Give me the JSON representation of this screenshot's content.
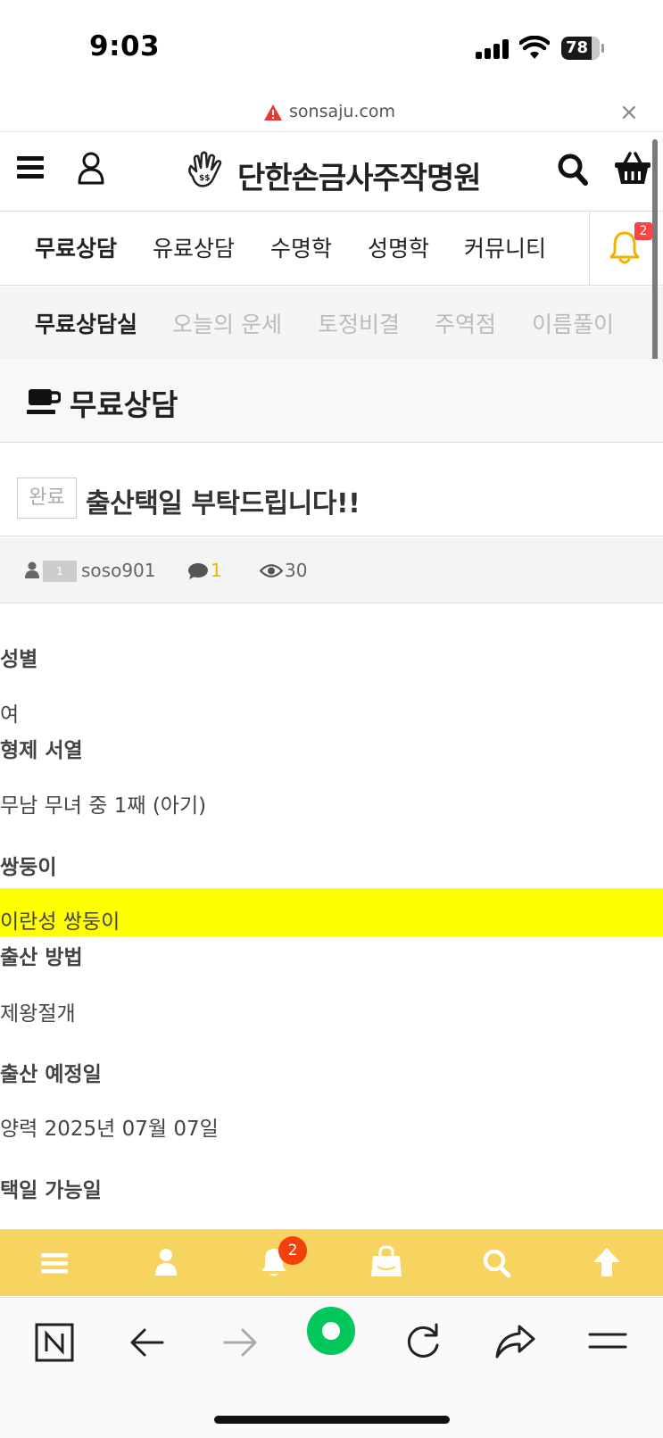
{
  "status_bar": {
    "time": "9:03",
    "battery": "78"
  },
  "url_bar": {
    "domain": "sonsaju.com",
    "close": "×"
  },
  "header": {
    "logo_text": "단한손금사주작명원"
  },
  "main_nav": {
    "items": [
      {
        "label": "무료상담"
      },
      {
        "label": "유료상담"
      },
      {
        "label": "수명학"
      },
      {
        "label": "성명학"
      },
      {
        "label": "커뮤니티"
      }
    ],
    "notification_count": "2"
  },
  "sub_nav": {
    "items": [
      {
        "label": "무료상담실"
      },
      {
        "label": "오늘의 운세"
      },
      {
        "label": "토정비결"
      },
      {
        "label": "주역점"
      },
      {
        "label": "이름풀이"
      }
    ]
  },
  "page": {
    "title": "무료상담"
  },
  "post": {
    "status": "완료",
    "title": "출산택일 부탁드립니다!!",
    "level": "1",
    "author": "soso901",
    "comments": "1",
    "views": "30"
  },
  "fields": [
    {
      "label": "성별",
      "value": "여"
    },
    {
      "label": "형제 서열",
      "value": "무남 무녀 중 1째 (아기)"
    },
    {
      "label": "쌍둥이",
      "value": "이란성 쌍둥이"
    },
    {
      "label": "출산 방법",
      "value": "제왕절개"
    },
    {
      "label": "출산 예정일",
      "value": "양력 2025년 07월 07일"
    },
    {
      "label": "택일 가능일",
      "value": ""
    }
  ],
  "bottom_bar": {
    "notification_count": "2"
  },
  "colors": {
    "accent_yellow": "#f7d35f",
    "highlight": "#ffff00",
    "badge_red": "#f2400a",
    "comment_count": "#f0b400",
    "toolbar_green": "#03c75a"
  }
}
